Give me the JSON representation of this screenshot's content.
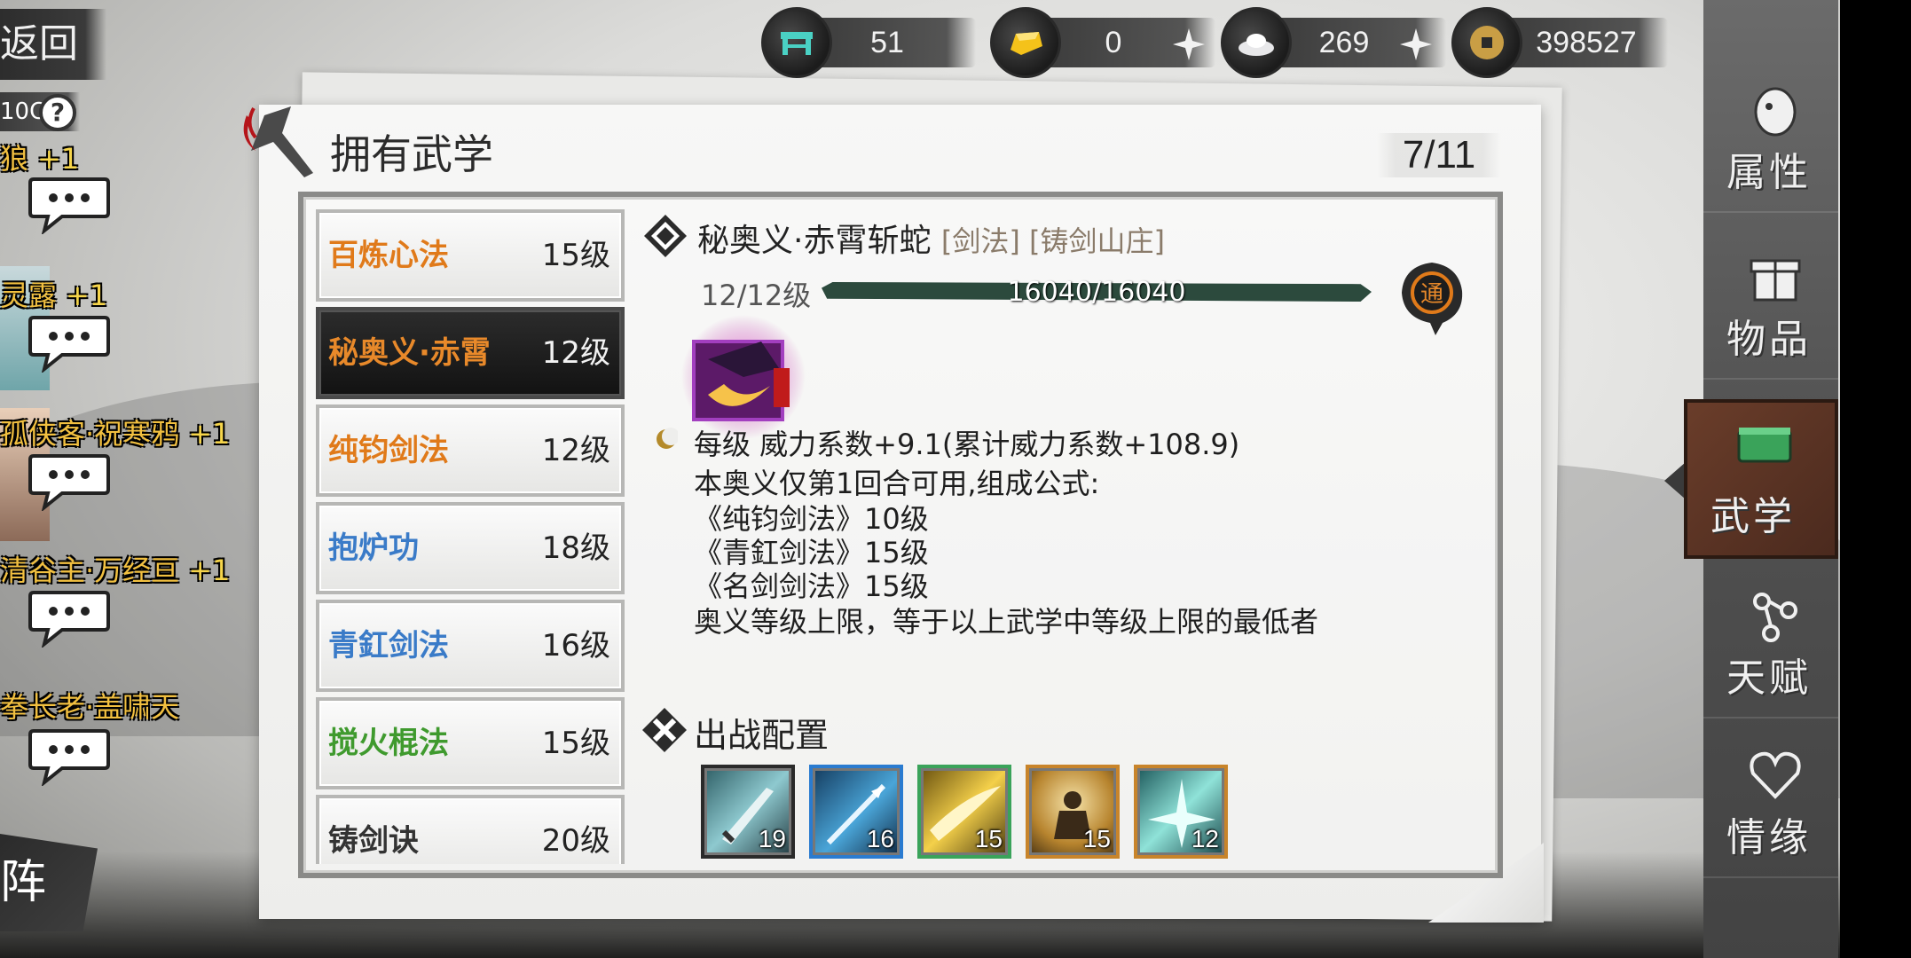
{
  "resources": {
    "furniture": "51",
    "gold": "0",
    "silver": "269",
    "coins": "398527"
  },
  "left_panel": {
    "back_label": "返回",
    "level_tag": "10C",
    "help_icon": "question-icon",
    "friends": [
      {
        "name": "狼",
        "bonus": "+1"
      },
      {
        "name": "灵露",
        "bonus": "+1"
      },
      {
        "name": "孤侠客·祝寒鸦",
        "bonus": "+1"
      },
      {
        "name": "清谷主·万经亘",
        "bonus": "+1"
      },
      {
        "name": "拳长老·盖啸天",
        "bonus": ""
      }
    ],
    "formation_label": "阵"
  },
  "panel": {
    "title": "拥有武学",
    "page_count": "7/11"
  },
  "skills": [
    {
      "name": "百炼心法",
      "level": "15级",
      "color": "#e07a1a",
      "selected": false
    },
    {
      "name": "秘奥义·赤霄",
      "level": "12级",
      "color": "#e07a1a",
      "selected": true
    },
    {
      "name": "纯钧剑法",
      "level": "12级",
      "color": "#e07a1a",
      "selected": false
    },
    {
      "name": "抱炉功",
      "level": "18级",
      "color": "#3a7bc8",
      "selected": false
    },
    {
      "name": "青釭剑法",
      "level": "16级",
      "color": "#3a7bc8",
      "selected": false
    },
    {
      "name": "搅火棍法",
      "level": "15级",
      "color": "#3f9a2e",
      "selected": false
    },
    {
      "name": "铸剑诀",
      "level": "20级",
      "color": "#333333",
      "selected": false
    }
  ],
  "detail": {
    "name": "秘奥义·赤霄斩蛇",
    "tags": "[剑法] [铸剑山庄]",
    "level": "12/12级",
    "exp": "16040/16040",
    "exp_fraction": 1.0,
    "tong_label": "通",
    "lines": [
      "每级   威力系数+9.1(累计威力系数+108.9)",
      "本奥义仅第1回合可用,组成公式:",
      "《纯钧剑法》10级",
      "《青釭剑法》15级",
      "《名剑剑法》15级",
      "奥义等级上限，等于以上武学中等级上限的最低者"
    ]
  },
  "deploy": {
    "title": "出战配置",
    "slots": [
      {
        "level": "19",
        "border": "#2a2a2a",
        "icon": "sword-icon"
      },
      {
        "level": "16",
        "border": "#2a7bd0",
        "icon": "spear-icon"
      },
      {
        "level": "15",
        "border": "#3aa35a",
        "icon": "blade-slash-icon"
      },
      {
        "level": "15",
        "border": "#c8842a",
        "icon": "meditation-icon"
      },
      {
        "level": "12",
        "border": "#c8842a",
        "icon": "sword-burst-icon"
      }
    ]
  },
  "nav": [
    {
      "label": "属性",
      "icon": "attribute-icon",
      "active": false
    },
    {
      "label": "物品",
      "icon": "gift-box-icon",
      "active": false
    },
    {
      "label": "武学",
      "icon": "scroll-icon",
      "active": true
    },
    {
      "label": "天赋",
      "icon": "talent-icon",
      "active": false
    },
    {
      "label": "情缘",
      "icon": "heart-knot-icon",
      "active": false
    }
  ]
}
